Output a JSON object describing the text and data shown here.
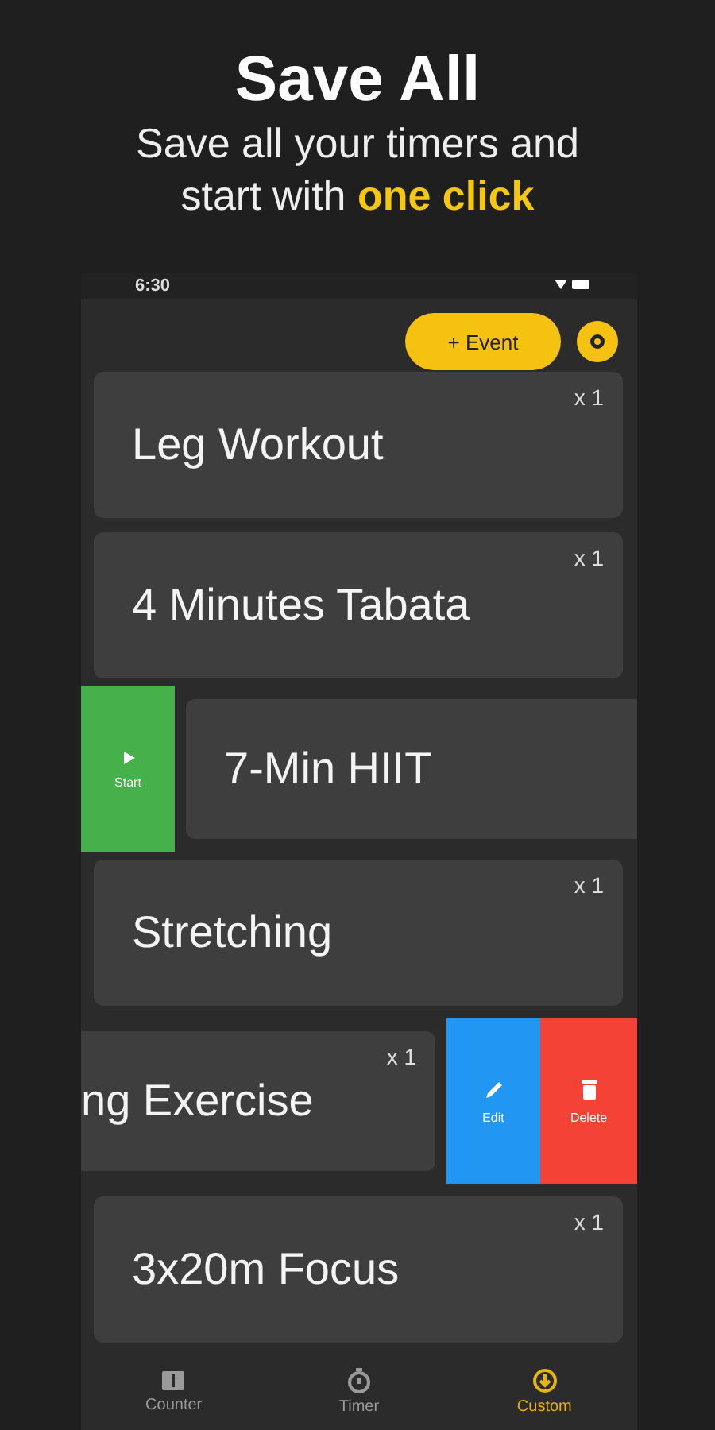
{
  "header": {
    "title": "Save All",
    "subtitle": "Save all your timers and",
    "subtitle_line2": "start with",
    "highlight": "one click"
  },
  "status_bar": {
    "time": "6:30"
  },
  "toolbar": {
    "event_button": "+ Event"
  },
  "timers": [
    {
      "kind": "normal",
      "name": "Leg Workout",
      "count": "x 1"
    },
    {
      "kind": "normal",
      "name": "4 Minutes Tabata",
      "count": "x 1"
    },
    {
      "kind": "start",
      "name": "7-Min HIIT",
      "action": "Start"
    },
    {
      "kind": "normal",
      "name": "Stretching",
      "count": "x 1"
    },
    {
      "kind": "edit",
      "name": "ng Exercise",
      "count": "x 1",
      "edit": "Edit",
      "delete": "Delete"
    },
    {
      "kind": "normal",
      "name": "3x20m Focus",
      "count": "x 1"
    }
  ],
  "tabs": [
    {
      "label": "Counter",
      "kind": "counter",
      "selected": false
    },
    {
      "label": "Timer",
      "kind": "timer",
      "selected": false
    },
    {
      "label": "Custom",
      "kind": "custom",
      "selected": true
    }
  ]
}
